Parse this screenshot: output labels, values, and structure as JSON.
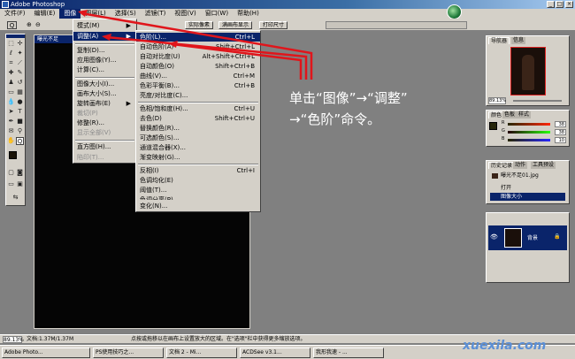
{
  "app": {
    "title": "Adobe Photoshop"
  },
  "menubar": [
    "文件(F)",
    "编辑(E)",
    "图像",
    "图层(L)",
    "选择(S)",
    "滤镜(T)",
    "视图(V)",
    "窗口(W)",
    "帮助(H)"
  ],
  "options_bar": {
    "buttons": [
      "实际像素",
      "满画布显示",
      "打印尺寸"
    ]
  },
  "document": {
    "title": "曝光不足"
  },
  "image_menu": {
    "items": [
      {
        "label": "模式(M)",
        "arrow": "▶",
        "shortcut": ""
      },
      {
        "label": "调整(A)",
        "arrow": "▶",
        "shortcut": ""
      },
      {
        "label": "复制(D)...",
        "shortcut": ""
      },
      {
        "label": "应用图像(Y)...",
        "shortcut": ""
      },
      {
        "label": "计算(C)...",
        "shortcut": ""
      },
      {
        "label": "图像大小(I)...",
        "shortcut": ""
      },
      {
        "label": "画布大小(S)...",
        "shortcut": ""
      },
      {
        "label": "旋转画布(E)",
        "arrow": "▶",
        "shortcut": ""
      },
      {
        "label": "裁切(P)",
        "shortcut": ""
      },
      {
        "label": "修整(R)...",
        "shortcut": ""
      },
      {
        "label": "显示全部(V)",
        "shortcut": ""
      },
      {
        "label": "直方图(H)...",
        "shortcut": ""
      },
      {
        "label": "陷印(T)...",
        "shortcut": ""
      }
    ]
  },
  "adjust_menu": {
    "items": [
      {
        "label": "色阶(L)...",
        "shortcut": "Ctrl+L"
      },
      {
        "label": "自动色阶(A)",
        "shortcut": "Shift+Ctrl+L"
      },
      {
        "label": "自动对比度(U)",
        "shortcut": "Alt+Shift+Ctrl+L"
      },
      {
        "label": "自动颜色(O)",
        "shortcut": "Shift+Ctrl+B"
      },
      {
        "label": "曲线(V)...",
        "shortcut": "Ctrl+M"
      },
      {
        "label": "色彩平衡(B)...",
        "shortcut": "Ctrl+B"
      },
      {
        "label": "亮度/对比度(C)...",
        "shortcut": ""
      },
      {
        "label": "色相/饱和度(H)...",
        "shortcut": "Ctrl+U"
      },
      {
        "label": "去色(D)",
        "shortcut": "Shift+Ctrl+U"
      },
      {
        "label": "替换颜色(R)...",
        "shortcut": ""
      },
      {
        "label": "可选颜色(S)...",
        "shortcut": ""
      },
      {
        "label": "通道混合器(X)...",
        "shortcut": ""
      },
      {
        "label": "渐变映射(G)...",
        "shortcut": ""
      },
      {
        "label": "反相(I)",
        "shortcut": "Ctrl+I"
      },
      {
        "label": "色调均化(E)",
        "shortcut": ""
      },
      {
        "label": "阈值(T)...",
        "shortcut": ""
      },
      {
        "label": "色调分离(P)...",
        "shortcut": ""
      },
      {
        "label": "变化(N)...",
        "shortcut": ""
      }
    ]
  },
  "navigator": {
    "tabs": [
      "导航器",
      "信息"
    ],
    "zoom": "89.13%"
  },
  "color_panel": {
    "tabs": [
      "颜色",
      "色板",
      "样式"
    ],
    "r": "38",
    "g": "38",
    "b": "10",
    "labels": [
      "R",
      "G",
      "B"
    ]
  },
  "history_panel": {
    "tabs": [
      "历史记录",
      "动作",
      "工具预设"
    ],
    "snapshot": "曝光不足01.jpg",
    "steps": [
      "打开",
      "图像大小"
    ]
  },
  "layers_panel": {
    "layer_name": "背景"
  },
  "status": {
    "zoom": "89.13%",
    "doc": "文档:1.37M/1.37M",
    "hint": "点按或拖移以在画布上设置放大的区域。在\"选项\"栏中获得更多缩放选项。"
  },
  "taskbar": {
    "items": [
      "Adobe Photo...",
      "PS使用技巧之...",
      "文档 2 - Mi...",
      "ACDSee v3.1...",
      "我形我速 - ..."
    ]
  },
  "annotation": {
    "line1": "单击“图像”→“调整”",
    "line2": "→“色阶”命令。"
  },
  "watermark": "xuexila.com",
  "colors": {
    "title_bar": "#0a246a",
    "arrow": "#e0151b",
    "chrome": "#d4d0c8",
    "workspace": "#808080"
  }
}
